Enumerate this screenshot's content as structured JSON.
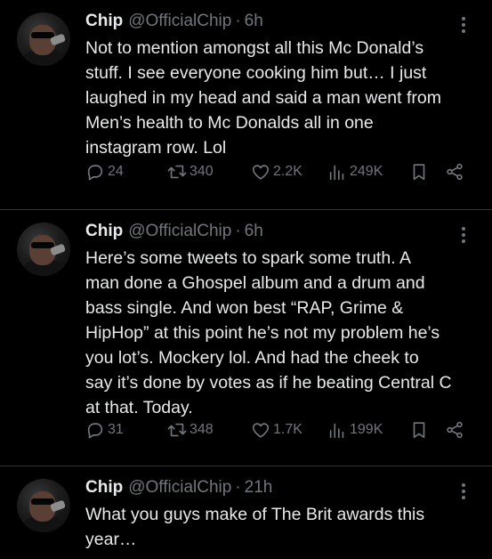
{
  "tweets": [
    {
      "name": "Chip",
      "handle": "@OfficialChip",
      "separator": "·",
      "time": "6h",
      "text": "Not to mention amongst all this Mc Donald’s\nstuff. I see everyone cooking him but… I just\nlaughed in my head and said a man went from\nMen’s health to Mc Donalds all in one\ninstagram row. Lol",
      "replies": "24",
      "retweets": "340",
      "likes": "2.2K",
      "views": "249K"
    },
    {
      "name": "Chip",
      "handle": "@OfficialChip",
      "separator": "·",
      "time": "6h",
      "text": "Here’s some tweets to spark some truth. A\nman done a Ghospel album and a drum and\nbass single. And won best “RAP, Grime &\nHipHop” at this point he’s not my problem he’s\nyou lot’s. Mockery lol. And had the cheek to\nsay it’s done by votes as if he beating Central C\nat that. Today.",
      "replies": "31",
      "retweets": "348",
      "likes": "1.7K",
      "views": "199K"
    },
    {
      "name": "Chip",
      "handle": "@OfficialChip",
      "separator": "·",
      "time": "21h",
      "text": "What you guys make of The Brit awards this\nyear…"
    }
  ],
  "icons": {
    "reply": "reply-icon",
    "retweet": "retweet-icon",
    "like": "heart-icon",
    "views": "views-icon",
    "bookmark": "bookmark-icon",
    "share": "share-icon",
    "more": "more-icon"
  },
  "colors": {
    "background": "#000000",
    "text": "#e7e9ea",
    "muted": "#71767b",
    "divider": "#2f3336"
  }
}
